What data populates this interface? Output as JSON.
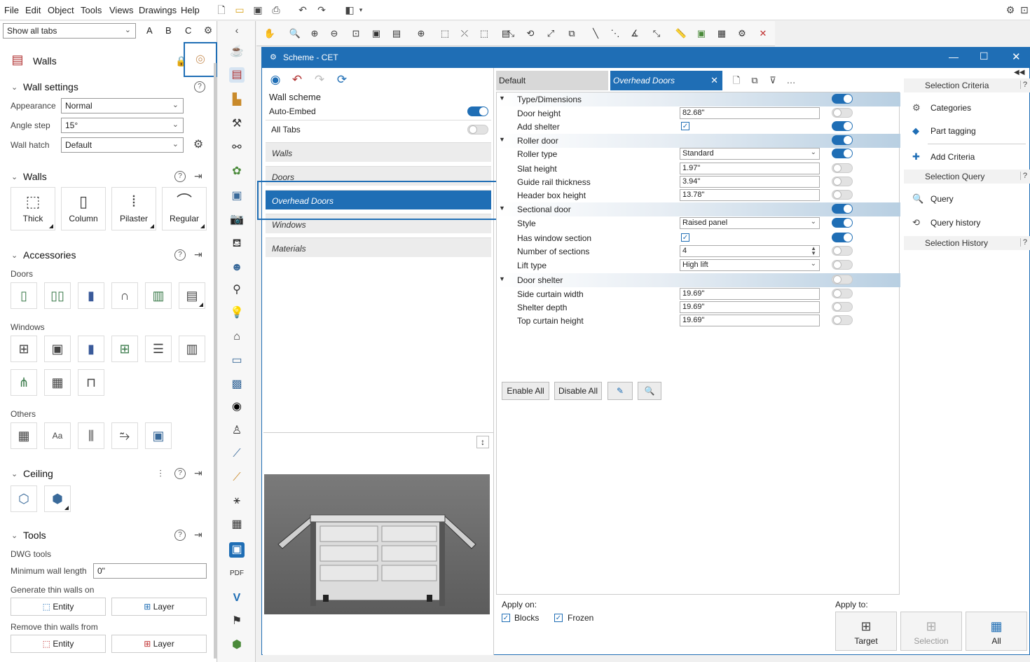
{
  "menu": {
    "file": "File",
    "edit": "Edit",
    "object": "Object",
    "tools": "Tools",
    "views": "Views",
    "drawings": "Drawings",
    "help": "Help"
  },
  "left": {
    "tabs_select": "Show all tabs",
    "abc": [
      "A",
      "B",
      "C"
    ],
    "panel_title": "Walls",
    "wall_settings": {
      "title": "Wall settings",
      "appearance_label": "Appearance",
      "appearance_value": "Normal",
      "angle_label": "Angle step",
      "angle_value": "15°",
      "hatch_label": "Wall hatch",
      "hatch_value": "Default"
    },
    "walls": {
      "title": "Walls",
      "buttons": [
        "Thick",
        "Column",
        "Pilaster",
        "Regular"
      ]
    },
    "accessories": {
      "title": "Accessories",
      "doors_label": "Doors",
      "windows_label": "Windows",
      "others_label": "Others"
    },
    "ceiling": {
      "title": "Ceiling"
    },
    "tools": {
      "title": "Tools",
      "dwg_label": "DWG tools",
      "min_len_label": "Minimum wall length",
      "min_len_value": "0\"",
      "gen_label": "Generate thin walls on",
      "remove_label": "Remove thin walls from",
      "entity": "Entity",
      "layer": "Layer"
    }
  },
  "dialog": {
    "title": "Scheme - CET",
    "scheme_label": "Wall scheme",
    "auto_embed": "Auto-Embed",
    "all_tabs": "All Tabs",
    "tabs": [
      "Walls",
      "Doors",
      "Overhead Doors",
      "Windows",
      "Materials"
    ],
    "grid_tabs": {
      "default": "Default",
      "active": "Overhead Doors"
    },
    "rows": [
      {
        "type": "hdr",
        "name": "Type/Dimensions",
        "on": true
      },
      {
        "type": "text",
        "name": "Door height",
        "value": "82.68\"",
        "on": false
      },
      {
        "type": "check",
        "name": "Add shelter",
        "on": true
      },
      {
        "type": "hdr",
        "name": "Roller door",
        "on": true
      },
      {
        "type": "select",
        "name": "Roller type",
        "value": "Standard",
        "on": true
      },
      {
        "type": "text",
        "name": "Slat height",
        "value": "1.97\"",
        "on": false
      },
      {
        "type": "text",
        "name": "Guide rail thickness",
        "value": "3.94\"",
        "on": false
      },
      {
        "type": "text",
        "name": "Header box height",
        "value": "13.78\"",
        "on": false
      },
      {
        "type": "hdr",
        "name": "Sectional door",
        "on": true
      },
      {
        "type": "select",
        "name": "Style",
        "value": "Raised panel",
        "on": true
      },
      {
        "type": "check",
        "name": "Has window section",
        "on": true
      },
      {
        "type": "spin",
        "name": "Number of sections",
        "value": "4",
        "on": false
      },
      {
        "type": "select",
        "name": "Lift type",
        "value": "High lift",
        "on": false
      },
      {
        "type": "hdr",
        "name": "Door shelter",
        "on": false
      },
      {
        "type": "text",
        "name": "Side curtain width",
        "value": "19.69\"",
        "on": false
      },
      {
        "type": "text",
        "name": "Shelter depth",
        "value": "19.69\"",
        "on": false
      },
      {
        "type": "text",
        "name": "Top curtain height",
        "value": "19.69\"",
        "on": false
      }
    ],
    "enable_all": "Enable All",
    "disable_all": "Disable All",
    "apply_on": "Apply on:",
    "blocks": "Blocks",
    "frozen": "Frozen",
    "apply_to": "Apply to:",
    "apply_buttons": [
      "Target",
      "Selection",
      "All"
    ],
    "right": {
      "selection_criteria": "Selection Criteria",
      "categories": "Categories",
      "part_tagging": "Part tagging",
      "add_criteria": "Add Criteria",
      "selection_query": "Selection Query",
      "query": "Query",
      "query_history": "Query history",
      "selection_history": "Selection History",
      "q": "?"
    }
  },
  "colors": {
    "accent": "#1f6eb5",
    "highlight_box": "#1f6eb5"
  }
}
